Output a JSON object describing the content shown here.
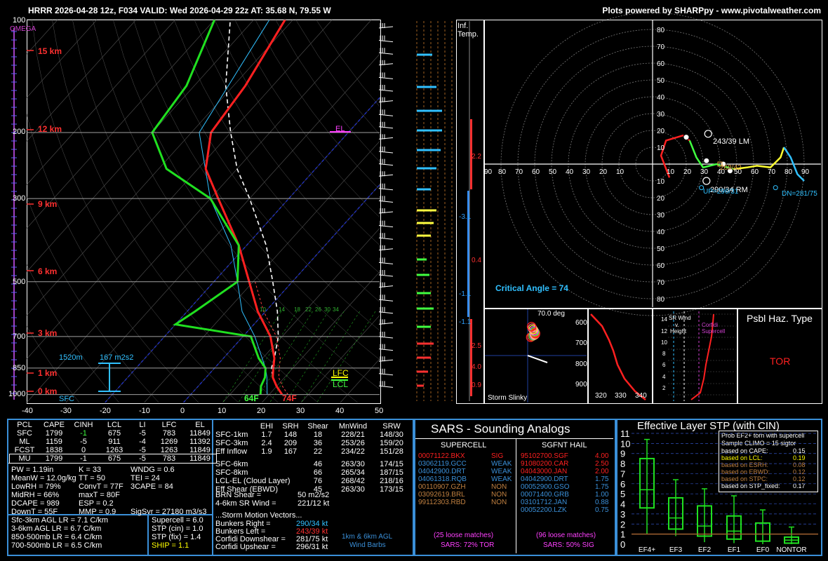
{
  "header": {
    "left": "HRRR 2026-04-28 12z, F034  VALID: Wed 2026-04-29 22z  AT: 35.68 N, 79.55 W",
    "right": "Plots powered by SHARPpy - www.pivotalweather.com"
  },
  "skewt": {
    "omega_label": "OMEGA",
    "pressure_ticks": [
      "100",
      "200",
      "300",
      "500",
      "700",
      "850",
      "1000"
    ],
    "height_labels": [
      "15 km",
      "12 km",
      "9 km",
      "6 km",
      "3 km",
      "1 km",
      "0 km"
    ],
    "temp_ticks": [
      "-40",
      "-30",
      "-20",
      "-10",
      "0",
      "10",
      "20",
      "30",
      "40",
      "50"
    ],
    "el_label": "EL",
    "lfc_label": "LFC",
    "lcl_label": "LCL",
    "sfc_label": "SFC",
    "sfc_dewpoint": "64F",
    "sfc_temp": "74F",
    "inflow_depth": "1520m",
    "inflow_srh": "167 m2s2",
    "hodo_speed_labels": [
      "10",
      "14",
      "18",
      "22",
      "26",
      "30",
      "34"
    ],
    "colors": {
      "temp": "#ff2020",
      "dewpoint": "#20e020",
      "parcel": "#ffffff",
      "wetbulb": "#30c0ff",
      "hline": "#a0a0a0"
    }
  },
  "inferred_temp": {
    "title_line1": "Inf.",
    "title_line2": "Temp.",
    "values": [
      "2.2",
      "-3.1",
      "0.4",
      "-1.1",
      "-1.1",
      "2.5",
      "4.0",
      "0.9"
    ]
  },
  "hodograph": {
    "axis_labels_top": [
      "80",
      "70",
      "60",
      "50",
      "40",
      "30",
      "20",
      "10"
    ],
    "axis_labels_bottom": [
      "10",
      "20",
      "30",
      "40",
      "50",
      "60",
      "70",
      "80"
    ],
    "axis_labels_left": [
      "90",
      "80",
      "70",
      "60",
      "50",
      "40",
      "30",
      "20",
      "10"
    ],
    "axis_labels_right": [
      "10",
      "20",
      "30",
      "40",
      "50",
      "60",
      "70",
      "80",
      "90"
    ],
    "lm_label": "243/39 LM",
    "rm_label": "290/34 RM",
    "up_label": "UP=296/31",
    "dn_label": "DN=281/75",
    "mean_label": "268/42",
    "critical_angle": "Critical Angle = 74",
    "points": [
      "1",
      "2",
      "3",
      "4"
    ]
  },
  "storm_slinky": {
    "title": "Storm Slinky",
    "angle": "70.0 deg"
  },
  "theta": {
    "pressures": [
      "600",
      "700",
      "800",
      "900"
    ],
    "xticks": [
      "320",
      "330",
      "340"
    ]
  },
  "srwind": {
    "title_line1": "SR Wind",
    "title_line2": "v.",
    "title_line3": "Height",
    "yticks": [
      "14",
      "12",
      "10",
      "8",
      "6",
      "4",
      "2"
    ],
    "annot1": "Corfidi",
    "annot2": "Supercell"
  },
  "hazard": {
    "title": "Psbl Haz. Type",
    "value": "TOR"
  },
  "parcels": {
    "headers": [
      "PCL",
      "CAPE",
      "CINH",
      "LCL",
      "LI",
      "LFC",
      "EL"
    ],
    "rows": [
      [
        "SFC",
        "1799",
        "-1",
        "675",
        "-5",
        "783",
        "11849"
      ],
      [
        "ML",
        "1159",
        "-5",
        "911",
        "-4",
        "1269",
        "11392"
      ],
      [
        "FCST",
        "1838",
        "0",
        "1263",
        "-5",
        "1263",
        "11849"
      ],
      [
        "MU",
        "1799",
        "-1",
        "675",
        "-5",
        "783",
        "11849"
      ]
    ]
  },
  "indices": [
    [
      "PW = 1.19in",
      "K = 33",
      "WNDG = 0.6"
    ],
    [
      "MeanW = 12.0g/kg",
      "TT = 50",
      "TEI = 24"
    ],
    [
      "LowRH = 79%",
      "ConvT = 77F",
      "3CAPE = 84"
    ],
    [
      "MidRH = 66%",
      "maxT = 80F",
      ""
    ],
    [
      "DCAPE = 989",
      "ESP = 0.2",
      ""
    ],
    [
      "DownT = 55F",
      "MMP = 0.9",
      "SigSvr = 27180 m3/s3"
    ]
  ],
  "lapse": [
    "Sfc-3km AGL LR = 7.1 C/km",
    "3-6km AGL LR = 6.7 C/km",
    "850-500mb LR = 6.4 C/km",
    "700-500mb LR = 6.5 C/km"
  ],
  "composite": [
    {
      "label": "Supercell = 6.0",
      "color": "#ffffff"
    },
    {
      "label": "STP (cin) = 1.0",
      "color": "#ffffff"
    },
    {
      "label": "STP (fix) = 1.4",
      "color": "#ffffff"
    },
    {
      "label": "SHIP = 1.1",
      "color": "#ffff00"
    }
  ],
  "kinematics": {
    "headers": [
      "",
      "EHI",
      "SRH",
      "Shear",
      "MnWind",
      "SRW"
    ],
    "rows": [
      [
        "SFC-1km",
        "1.7",
        "148",
        "18",
        "228/21",
        "148/30"
      ],
      [
        "SFC-3km",
        "2.4",
        "209",
        "36",
        "253/26",
        "159/20"
      ],
      [
        "Eff Inflow",
        "1.9",
        "167",
        "22",
        "234/22",
        "151/28"
      ],
      [
        "SFC-6km",
        "",
        "",
        "46",
        "263/30",
        "174/15"
      ],
      [
        "SFC-8km",
        "",
        "",
        "66",
        "265/34",
        "187/15"
      ],
      [
        "LCL-EL (Cloud Layer)",
        "",
        "",
        "76",
        "268/42",
        "218/16"
      ],
      [
        "Eff Shear (EBWD)",
        "",
        "",
        "45",
        "263/30",
        "173/15"
      ]
    ],
    "brn_label": "BRN Shear =",
    "brn_value": "50 m2/s2",
    "sr46_label": "4-6km SR Wind =",
    "sr46_value": "221/12 kt",
    "vectors_title": "...Storm Motion Vectors...",
    "vectors": [
      {
        "label": "Bunkers Right =",
        "value": "290/34 kt",
        "color": "#30c0ff"
      },
      {
        "label": "Bunkers Left =",
        "value": "243/39 kt",
        "color": "#ff3030"
      },
      {
        "label": "Corfidi Downshear =",
        "value": "281/75 kt",
        "color": "#ffffff"
      },
      {
        "label": "Corfidi Upshear =",
        "value": "296/31 kt",
        "color": "#ffffff"
      }
    ],
    "barbs_line1": "1km & 6km AGL",
    "barbs_line2": "Wind Barbs"
  },
  "sars": {
    "title": "SARS - Sounding Analogs",
    "supercell_title": "SUPERCELL",
    "hail_title": "SGFNT HAIL",
    "supercell": [
      {
        "id": "00071122.BKX",
        "val": "SIG",
        "color": "#ff2020"
      },
      {
        "id": "03062119.GCC",
        "val": "WEAK",
        "color": "#3a8fd8"
      },
      {
        "id": "04042900.DRT",
        "val": "WEAK",
        "color": "#3a8fd8"
      },
      {
        "id": "04061318.RQB",
        "val": "WEAK",
        "color": "#3a8fd8"
      },
      {
        "id": "00110907.GZH",
        "val": "NON",
        "color": "#c08040"
      },
      {
        "id": "03092619.BRL",
        "val": "NON",
        "color": "#c08040"
      },
      {
        "id": "99112303.RBD",
        "val": "NON",
        "color": "#c08040"
      }
    ],
    "hail": [
      {
        "id": "95102700.SGF",
        "val": "4.00",
        "color": "#ff2020"
      },
      {
        "id": "91080200.CAR",
        "val": "2.50",
        "color": "#ff2020"
      },
      {
        "id": "04043000.JAN",
        "val": "2.00",
        "color": "#ff2020"
      },
      {
        "id": "04042900.DRT",
        "val": "1.75",
        "color": "#3a8fd8"
      },
      {
        "id": "00052900.GSO",
        "val": "1.75",
        "color": "#3a8fd8"
      },
      {
        "id": "00071400.GRB",
        "val": "1.00",
        "color": "#3a8fd8"
      },
      {
        "id": "03101712.JAN",
        "val": "0.88",
        "color": "#3a8fd8"
      },
      {
        "id": "00052200.LZK",
        "val": "0.75",
        "color": "#3a8fd8"
      }
    ],
    "supercell_matches": "(25 loose matches)",
    "supercell_sars": "SARS: 72% TOR",
    "hail_matches": "(96 loose matches)",
    "hail_sars": "SARS: 50% SIG"
  },
  "stp": {
    "title": "Effective Layer STP (with CIN)",
    "legend_title1": "Prob EF2+ torn with supercell",
    "legend_title2": "Sample CLIMO = 15 sigtor",
    "legend": [
      {
        "label": "based on CAPE:",
        "val": "0.15",
        "color": "#ffffff"
      },
      {
        "label": "based on LCL:",
        "val": "0.19",
        "color": "#ffff00"
      },
      {
        "label": "based on ESRH:",
        "val": "0.08",
        "color": "#c08040"
      },
      {
        "label": "based on EBWD:",
        "val": "0.12",
        "color": "#c08040"
      },
      {
        "label": "based on STPC:",
        "val": "0.12",
        "color": "#c08040"
      },
      {
        "label": "based on STP_fixed:",
        "val": "0.17",
        "color": "#ffffff"
      }
    ],
    "yticks": [
      "11",
      "10",
      "9",
      "8",
      "7",
      "6",
      "5",
      "4",
      "3",
      "2",
      "1",
      "0"
    ],
    "categories": [
      "EF4+",
      "EF3",
      "EF2",
      "EF1",
      "EF0",
      "NONTOR"
    ]
  },
  "chart_data": {
    "type": "line",
    "title": "HRRR 2026-04-28 12z, F034  VALID: Wed 2026-04-29 22z  AT: 35.68 N, 79.55 W",
    "series": [
      {
        "name": "temp",
        "points": [
          [
            1000,
            23.3
          ],
          [
            950,
            20
          ],
          [
            900,
            17
          ],
          [
            850,
            15
          ],
          [
            800,
            13
          ],
          [
            700,
            7
          ],
          [
            600,
            -2
          ],
          [
            500,
            -11
          ],
          [
            400,
            -22
          ],
          [
            300,
            -38
          ],
          [
            250,
            -48
          ],
          [
            200,
            -55
          ],
          [
            150,
            -57
          ],
          [
            100,
            -62
          ]
        ]
      },
      {
        "name": "dewpoint",
        "points": [
          [
            1000,
            17.8
          ],
          [
            950,
            16
          ],
          [
            900,
            15
          ],
          [
            850,
            13
          ],
          [
            800,
            9
          ],
          [
            700,
            2
          ],
          [
            650,
            -20
          ],
          [
            600,
            -18
          ],
          [
            500,
            -14
          ],
          [
            400,
            -22
          ],
          [
            300,
            -40
          ],
          [
            250,
            -58
          ],
          [
            200,
            -70
          ],
          [
            150,
            -72
          ],
          [
            100,
            -80
          ]
        ]
      }
    ],
    "xlabel": "",
    "ylabel": "",
    "xlim": [
      -40,
      50
    ],
    "ylim": [
      1050,
      100
    ],
    "stp_boxes": [
      {
        "name": "EF4+",
        "whisker": [
          1.0,
          10.4
        ],
        "box": [
          3.6,
          8.5
        ],
        "median": 5.4
      },
      {
        "name": "EF3",
        "whisker": [
          0.8,
          6.4
        ],
        "box": [
          1.5,
          4.6
        ],
        "median": 2.6
      },
      {
        "name": "EF2",
        "whisker": [
          0.2,
          5.5
        ],
        "box": [
          0.8,
          3.8
        ],
        "median": 1.8
      },
      {
        "name": "EF1",
        "whisker": [
          0.1,
          4.8
        ],
        "box": [
          0.5,
          2.8
        ],
        "median": 1.3
      },
      {
        "name": "EF0",
        "whisker": [
          0.0,
          3.4
        ],
        "box": [
          0.3,
          2.1
        ],
        "median": 1.0
      },
      {
        "name": "NONTOR",
        "whisker": [
          0.0,
          1.7
        ],
        "box": [
          0.1,
          0.7
        ],
        "median": 0.4
      }
    ],
    "stp_current": 1.0
  }
}
